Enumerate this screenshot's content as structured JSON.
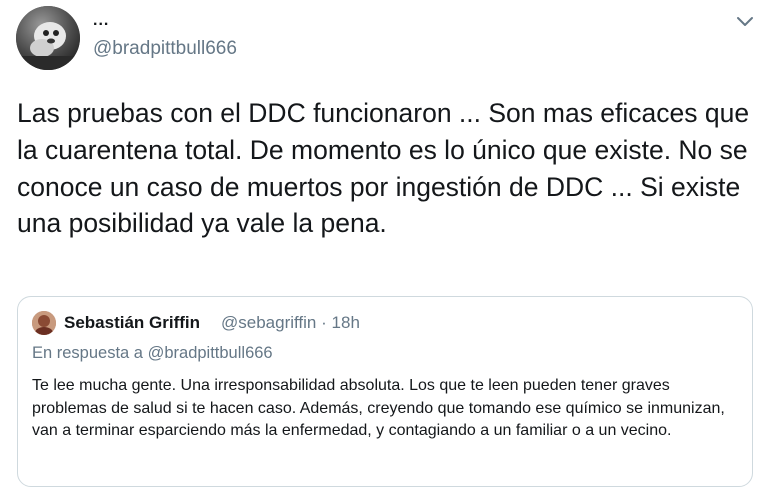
{
  "tweet": {
    "display_name": "...",
    "handle": "@bradpittbull666",
    "avatar_icon": "user-avatar-photo",
    "menu_icon": "chevron-down-icon",
    "text": "Las pruebas con el DDC funcionaron ...  Son mas eficaces que la cuarentena total. De momento es lo único que existe. No se conoce un caso de muertos por ingestión de DDC ... Si existe una posibilidad ya vale la pena."
  },
  "quoted_tweet": {
    "display_name": "Sebastián Griffin",
    "handle": "@sebagriffin",
    "separator": "·",
    "time": "18h",
    "reply_prefix": "En respuesta a",
    "reply_handle": "@bradpittbull666",
    "text": "Te lee mucha gente. Una irresponsabilidad absoluta. Los que te leen pueden tener graves problemas de salud si te hacen caso. Además, creyendo que tomando ese químico se inmunizan, van a terminar esparciendo más la enfermedad, y contagiando a un familiar o a un vecino."
  },
  "colors": {
    "text_primary": "#14171a",
    "text_secondary": "#657786",
    "border": "#cfd9de",
    "background": "#ffffff"
  }
}
